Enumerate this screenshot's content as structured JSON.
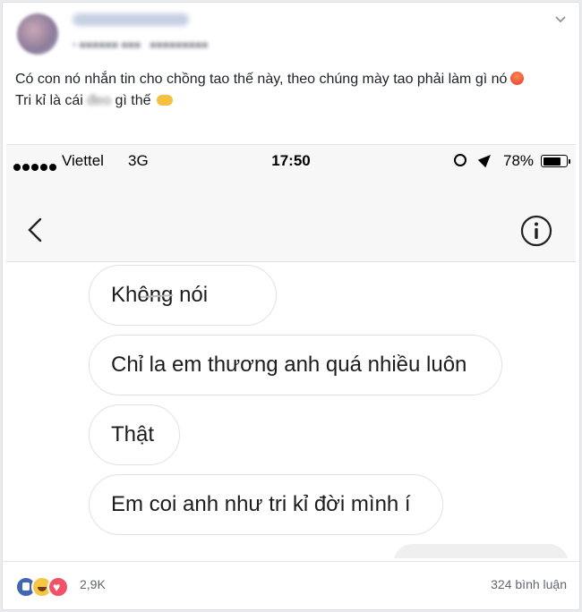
{
  "post": {
    "text_line1": "Có con nó nhắn tin cho chồng tao thế này, theo chúng mày tao phải làm gì nó",
    "text_line2_start": "Tri kỉ là cái",
    "text_line2_blurred": "đeo",
    "text_line2_end": "gì thế",
    "emoji_1": "angry-face-emoji",
    "emoji_2": "pointing-hand-emoji"
  },
  "status_bar": {
    "carrier": "Viettel",
    "network": "3G",
    "time": "17:50",
    "battery_percent": "78%",
    "battery_level": 0.78
  },
  "messages": [
    {
      "text": "Không nói"
    },
    {
      "text": "Chỉ la em thương anh quá nhiều luôn"
    },
    {
      "text": "Thật"
    },
    {
      "text": "Em coi anh như tri kỉ đời mình í"
    }
  ],
  "footer": {
    "reaction_count": "2,9K",
    "comment_count": "324 bình luận",
    "reaction_types": [
      "like",
      "haha",
      "love"
    ]
  },
  "colors": {
    "facebook_blue": "#4267b2",
    "haha_yellow": "#f7c544",
    "love_red": "#f25268",
    "bubble_border": "#e1e1e1"
  }
}
